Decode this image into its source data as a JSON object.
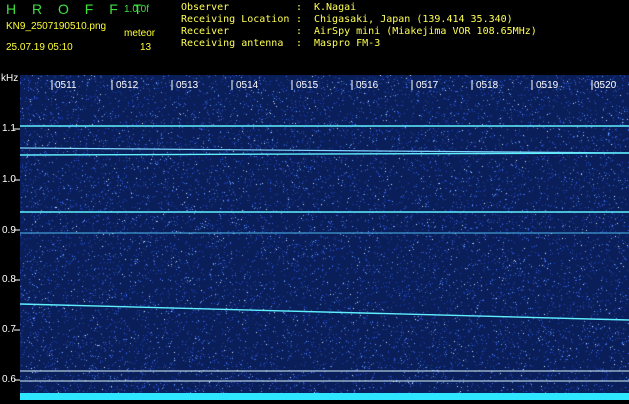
{
  "header": {
    "brand": "H R O F F T",
    "version": "1.0.0f",
    "filename": "KN9_2507190510.png",
    "timestamp": "25.07.19 05:10",
    "meteor_label": "meteor",
    "meteor_count": "13"
  },
  "info": [
    {
      "label": "Observer",
      "value": "K.Nagai"
    },
    {
      "label": "Receiving Location",
      "value": "Chigasaki, Japan (139.414 35.340)"
    },
    {
      "label": "Receiver",
      "value": "AirSpy mini (Miakejima VOR 108.65MHz)"
    },
    {
      "label": "Receiving antenna",
      "value": "Maspro FM-3"
    }
  ],
  "axis": {
    "y_unit": "kHz",
    "y_ticks": [
      "1.1",
      "1.0",
      "0.9",
      "0.8",
      "0.7",
      "0.6"
    ],
    "x_ticks": [
      "0511",
      "0512",
      "0513",
      "0514",
      "0515",
      "0516",
      "0517",
      "0518",
      "0519",
      "0520"
    ]
  },
  "colors": {
    "background": "#0a1f5a",
    "signal": "#5ff0ff",
    "header_green": "#3fe03f",
    "header_yellow": "#ffff33"
  }
}
